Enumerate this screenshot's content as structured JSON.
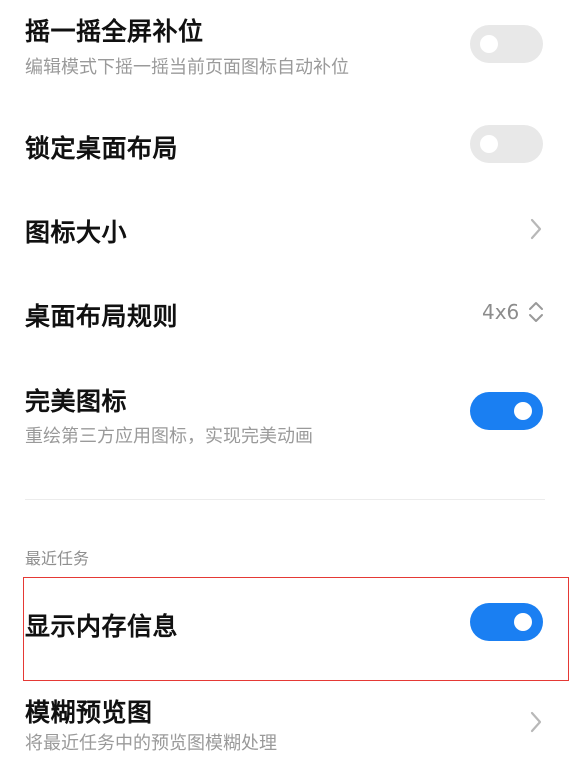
{
  "settings": {
    "shake_fill": {
      "title": "摇一摇全屏补位",
      "subtitle": "编辑模式下摇一摇当前页面图标自动补位",
      "enabled": false
    },
    "lock_layout": {
      "title": "锁定桌面布局",
      "enabled": false
    },
    "icon_size": {
      "title": "图标大小"
    },
    "layout_rule": {
      "title": "桌面布局规则",
      "value": "4x6"
    },
    "perfect_icons": {
      "title": "完美图标",
      "subtitle": "重绘第三方应用图标，实现完美动画",
      "enabled": true
    }
  },
  "recent_tasks": {
    "section_label": "最近任务",
    "show_memory": {
      "title": "显示内存信息",
      "enabled": true
    },
    "blur_preview": {
      "title": "模糊预览图",
      "subtitle": "将最近任务中的预览图模糊处理"
    }
  },
  "colors": {
    "accent": "#1a7ff2",
    "toggle_off": "#e8e8e8",
    "highlight_border": "#e53935"
  }
}
